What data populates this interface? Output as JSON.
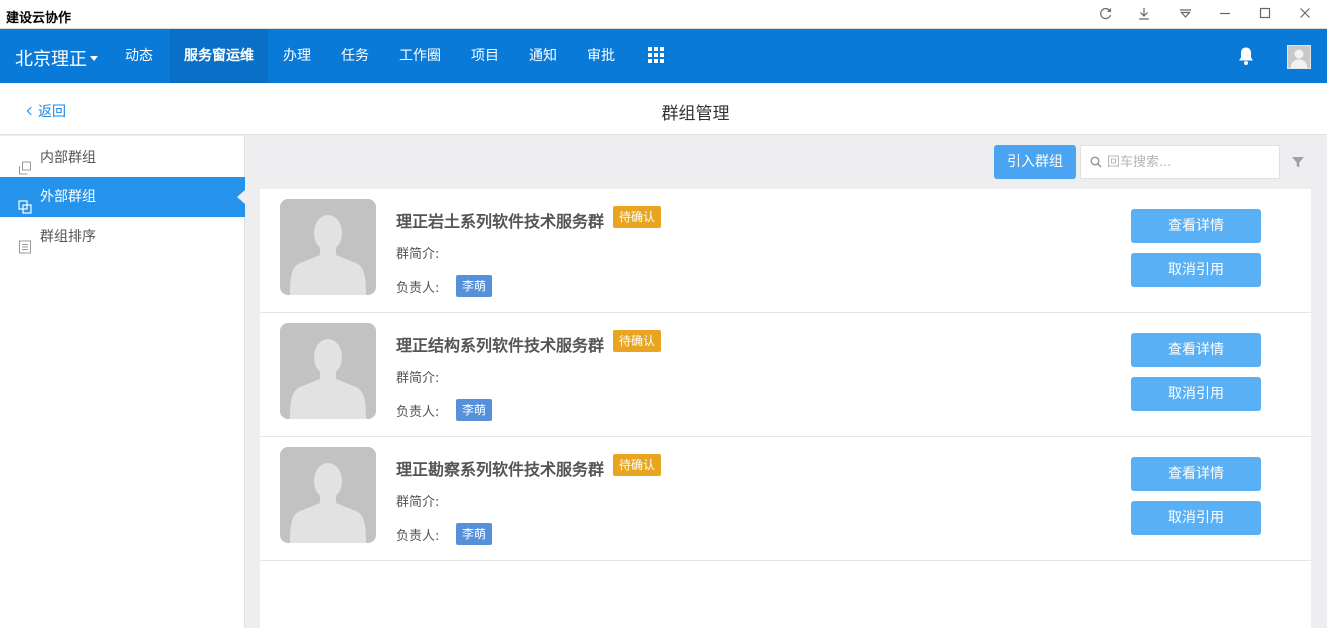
{
  "window": {
    "title": "建设云协作",
    "controls": [
      "refresh-icon",
      "download-icon",
      "dropdown-icon",
      "minimize-icon",
      "maximize-icon",
      "close-icon"
    ]
  },
  "nav": {
    "brand": "北京理正",
    "items": [
      "动态",
      "服务窗运维",
      "办理",
      "任务",
      "工作圈",
      "项目",
      "通知",
      "审批"
    ],
    "active": "服务窗运维",
    "accent": "#0a7ad8"
  },
  "header": {
    "back_label": "返回",
    "title": "群组管理"
  },
  "sidebar": {
    "items": [
      {
        "label": "内部群组",
        "icon": "group-icon"
      },
      {
        "label": "外部群组",
        "icon": "external-group-icon"
      },
      {
        "label": "群组排序",
        "icon": "sort-list-icon"
      }
    ],
    "active": "外部群组"
  },
  "toolbar": {
    "import_label": "引入群组",
    "search_placeholder": "回车搜索...",
    "filter_icon": "filter-icon"
  },
  "groups": [
    {
      "name": "理正岩土系列软件技术服务群",
      "status": "待确认",
      "intro_label": "群简介:",
      "owner_label": "负责人:",
      "owner": "李萌",
      "detail_label": "查看详情",
      "cancel_label": "取消引用"
    },
    {
      "name": "理正结构系列软件技术服务群",
      "status": "待确认",
      "intro_label": "群简介:",
      "owner_label": "负责人:",
      "owner": "李萌",
      "detail_label": "查看详情",
      "cancel_label": "取消引用"
    },
    {
      "name": "理正勘察系列软件技术服务群",
      "status": "待确认",
      "intro_label": "群简介:",
      "owner_label": "负责人:",
      "owner": "李萌",
      "detail_label": "查看详情",
      "cancel_label": "取消引用"
    }
  ],
  "colors": {
    "badge": "#e7a520",
    "owner_tag": "#5590d8",
    "button": "#5ab0f5"
  }
}
